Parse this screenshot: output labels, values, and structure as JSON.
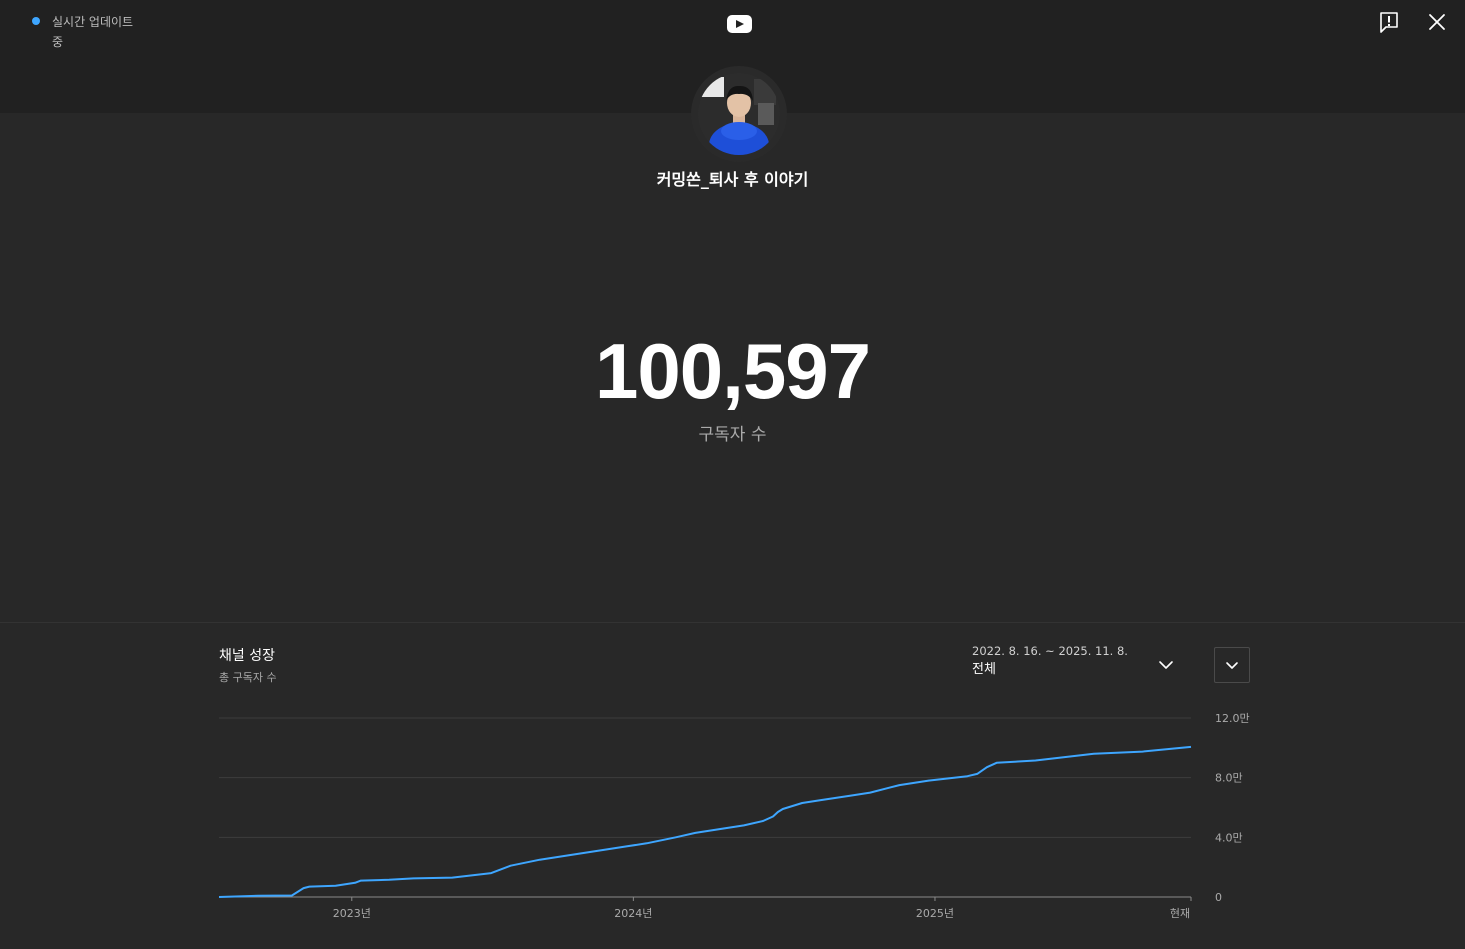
{
  "live": {
    "text": "실시간 업데이트 중"
  },
  "channel": {
    "name": "커밍쏜_퇴사 후 이야기"
  },
  "subscribers": {
    "count": "100,597",
    "label": "구독자 수"
  },
  "growth": {
    "title": "채널 성장",
    "subtitle": "총 구독자 수",
    "range_dates": "2022. 8. 16. ~ 2025. 11. 8.",
    "range_period": "전체"
  },
  "colors": {
    "accent": "#3ea6ff",
    "line": "#3ea6ff"
  },
  "icons": {
    "report": "report-flag-icon",
    "close": "close-icon",
    "range": "chevron-down-icon",
    "expand": "chevron-down-icon",
    "logo": "youtube-logo-icon"
  },
  "chart_data": {
    "type": "line",
    "title": "채널 성장",
    "ylabel": "",
    "xlabel": "",
    "ylim": [
      0,
      120000
    ],
    "y_ticks": [
      {
        "value": 0,
        "label": "0"
      },
      {
        "value": 40000,
        "label": "4.0만"
      },
      {
        "value": 80000,
        "label": "8.0만"
      },
      {
        "value": 120000,
        "label": "12.0만"
      }
    ],
    "x_ticks": [
      {
        "value": 0.1366,
        "label": "2023년"
      },
      {
        "value": 0.4263,
        "label": "2024년"
      },
      {
        "value": 0.7366,
        "label": "2025년"
      },
      {
        "value": 1.0,
        "label": "현재"
      }
    ],
    "grid": true,
    "series": [
      {
        "x": [
          0,
          0.04,
          0.075,
          0.087,
          0.093,
          0.12,
          0.14,
          0.146,
          0.175,
          0.2,
          0.24,
          0.28,
          0.3,
          0.33,
          0.35,
          0.36,
          0.37,
          0.4,
          0.42,
          0.44,
          0.47,
          0.49,
          0.52,
          0.54,
          0.56,
          0.57,
          0.575,
          0.58,
          0.6,
          0.62,
          0.65,
          0.67,
          0.7,
          0.73,
          0.77,
          0.78,
          0.79,
          0.8,
          0.84,
          0.86,
          0.9,
          0.95,
          1.0
        ],
        "y": [
          0,
          800,
          1000,
          6000,
          7000,
          7500,
          9500,
          11000,
          11500,
          12500,
          13000,
          16000,
          21000,
          25000,
          27000,
          28000,
          29000,
          32000,
          34000,
          36000,
          40000,
          43000,
          46000,
          48000,
          51000,
          54000,
          57000,
          59000,
          63000,
          65000,
          68000,
          70000,
          75000,
          78000,
          81000,
          82500,
          87000,
          90000,
          91500,
          93000,
          96000,
          97500,
          100597
        ]
      }
    ]
  }
}
